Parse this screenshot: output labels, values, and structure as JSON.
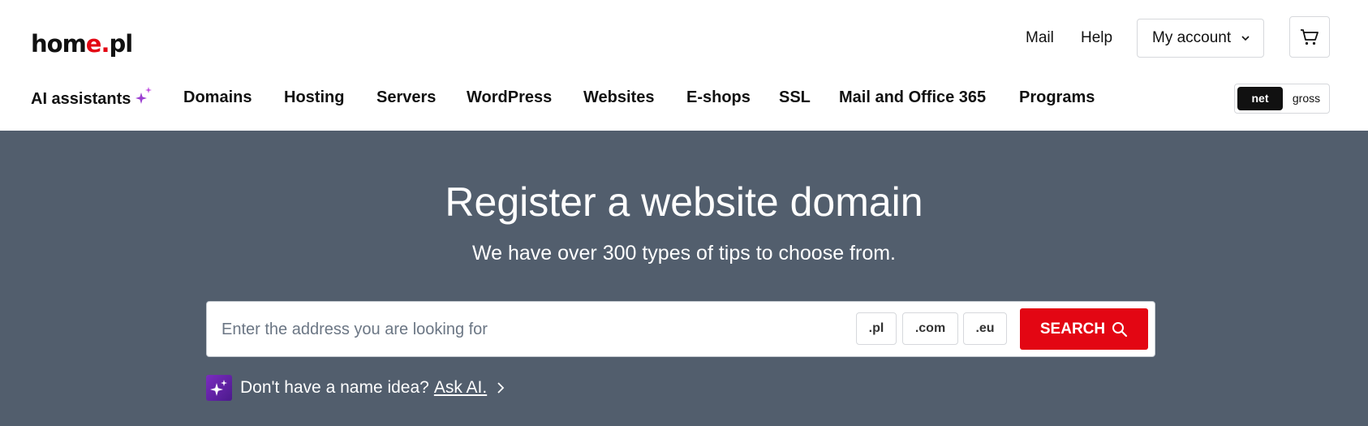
{
  "brand": {
    "logo_part1": "hom",
    "logo_accent": "e.",
    "logo_part2": "pl",
    "accent_color": "#e30613"
  },
  "top_links": {
    "mail": "Mail",
    "help": "Help",
    "account": "My account",
    "cart_icon": "cart-icon"
  },
  "nav": {
    "items": [
      {
        "label": "AI assistants",
        "icon": "sparkle-icon"
      },
      {
        "label": "Domains"
      },
      {
        "label": "Hosting"
      },
      {
        "label": "Servers"
      },
      {
        "label": "WordPress"
      },
      {
        "label": "Websites"
      },
      {
        "label": "E-shops"
      },
      {
        "label": "SSL"
      },
      {
        "label": "Mail and Office 365"
      },
      {
        "label": "Programs"
      }
    ]
  },
  "price_toggle": {
    "net": "net",
    "gross": "gross",
    "selected": "net"
  },
  "hero": {
    "title": "Register a website domain",
    "subtitle": "We have over 300 types of tips to choose from.",
    "background_color": "#525e6d"
  },
  "search": {
    "placeholder": "Enter the address you are looking for",
    "value": "",
    "tlds": [
      ".pl",
      ".com",
      ".eu"
    ],
    "button_label": "SEARCH",
    "button_color": "#e30613"
  },
  "ai_prompt": {
    "text": "Don't have a name idea?",
    "link": "Ask AI."
  }
}
